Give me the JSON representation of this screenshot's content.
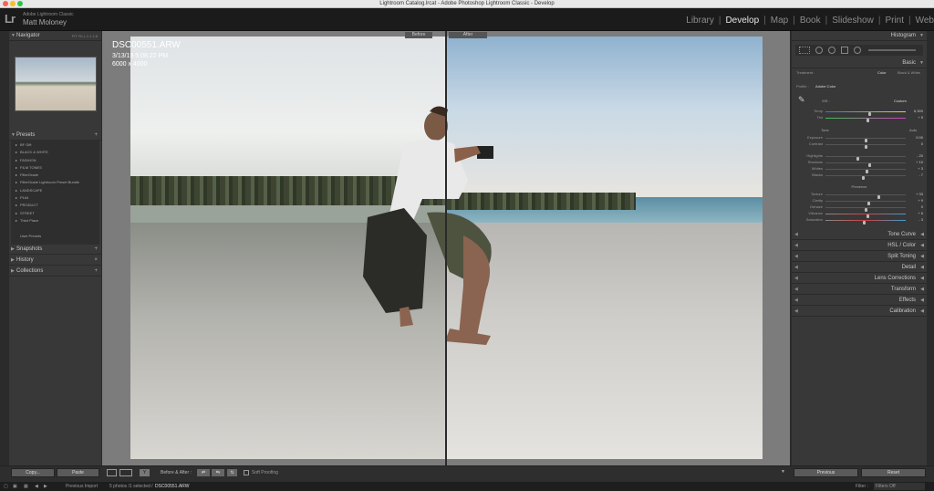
{
  "window": {
    "title": "Lightroom Catalog.lrcat - Adobe Photoshop Lightroom Classic - Develop"
  },
  "identity": {
    "logo": "Lr",
    "app_name": "Adobe Lightroom Classic",
    "user": "Matt Moloney"
  },
  "modules": [
    "Library",
    "Develop",
    "Map",
    "Book",
    "Slideshow",
    "Print",
    "Web"
  ],
  "active_module": "Develop",
  "left_panel": {
    "navigator": {
      "title": "Navigator",
      "modes": "FIT  FILL  1:1  1:8"
    },
    "presets": {
      "title": "Presets",
      "items": [
        "BF Gift",
        "BLACK & WHITE",
        "FASHION",
        "FILM TONES",
        "FilterGrade",
        "FilterGrade Lightroom Preset Bundle",
        "LANDSCAPE",
        "P164",
        "PRODUCT",
        "STREET",
        "Third Place"
      ],
      "user_presets": "User Presets"
    },
    "snapshots": "Snapshots",
    "history": "History",
    "collections": "Collections"
  },
  "photo": {
    "filename": "DSC00551.ARW",
    "datetime": "3/13/19 5:08:22 PM",
    "dimensions": "6000 x 4000",
    "before_label": "Before",
    "after_label": "After"
  },
  "right_panel": {
    "histogram": "Histogram",
    "basic": {
      "title": "Basic",
      "treatment_label": "Treatment :",
      "treatment_color": "Color",
      "treatment_bw": "Black & White",
      "profile_label": "Profile :",
      "profile_value": "Adobe Color",
      "wb_label": "WB :",
      "wb_value": "Custom",
      "tone_label": "Tone",
      "auto_label": "Auto",
      "presence_label": "Presence",
      "sliders_wb": [
        {
          "label": "Temp",
          "value": "6,300",
          "pos": 0.55
        },
        {
          "label": "Tint",
          "value": "+ 5",
          "pos": 0.53
        }
      ],
      "sliders_tone1": [
        {
          "label": "Exposure",
          "value": "0.00",
          "pos": 0.5
        },
        {
          "label": "Contrast",
          "value": "0",
          "pos": 0.5
        }
      ],
      "sliders_tone2": [
        {
          "label": "Highlights",
          "value": "- 20",
          "pos": 0.4
        },
        {
          "label": "Shadows",
          "value": "+ 10",
          "pos": 0.55
        },
        {
          "label": "Whites",
          "value": "+ 3",
          "pos": 0.52
        },
        {
          "label": "Blacks",
          "value": "- 7",
          "pos": 0.47
        }
      ],
      "sliders_presence": [
        {
          "label": "Texture",
          "value": "+ 33",
          "pos": 0.66
        },
        {
          "label": "Clarity",
          "value": "+ 9",
          "pos": 0.54
        },
        {
          "label": "Dehaze",
          "value": "0",
          "pos": 0.5
        },
        {
          "label": "Vibrance",
          "value": "+ 6",
          "pos": 0.53
        },
        {
          "label": "Saturation",
          "value": "- 3",
          "pos": 0.48
        }
      ]
    },
    "sections": [
      "Tone Curve",
      "HSL / Color",
      "Split Toning",
      "Detail",
      "Lens Corrections",
      "Transform",
      "Effects",
      "Calibration"
    ]
  },
  "toolbar": {
    "copy": "Copy...",
    "paste": "Paste",
    "before_after": "Before & After :",
    "soft_proofing": "Soft Proofing",
    "previous": "Previous",
    "reset": "Reset"
  },
  "status": {
    "previous_import": "Previous Import",
    "photos": "5 photos /1 selected /",
    "selected_file": "DSC00551.ARW",
    "filter_label": "Filter :",
    "filter_value": "Filters Off"
  }
}
